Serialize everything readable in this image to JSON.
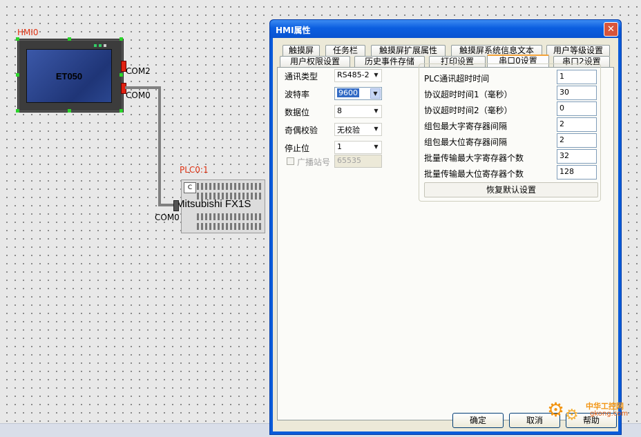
{
  "canvas": {
    "hmi_label": "HMI0",
    "hmi_model": "ET050",
    "hmi_port_com2": "COM2",
    "hmi_port_com0": "COM0",
    "plc_label": "PLC0:1",
    "plc_model": "Mitsubishi FX1S",
    "plc_port": "COM0",
    "plc_small_label": "C"
  },
  "dialog": {
    "title": "HMI属性",
    "close_label": "✕",
    "tabs_row1": [
      "触摸屏",
      "任务栏",
      "触摸屏扩展属性",
      "触摸屏系统信息文本",
      "用户等级设置"
    ],
    "tabs_row2": [
      "用户权限设置",
      "历史事件存储",
      "打印设置",
      "串口0设置",
      "串口2设置"
    ],
    "active_tab": "串口0设置",
    "left_fields": [
      {
        "label": "通讯类型",
        "value": "RS485-2"
      },
      {
        "label": "波特率",
        "value": "9600"
      },
      {
        "label": "数据位",
        "value": "8"
      },
      {
        "label": "奇偶校验",
        "value": "无校验"
      },
      {
        "label": "停止位",
        "value": "1"
      }
    ],
    "broadcast": {
      "label": "广播站号",
      "value": "65535"
    },
    "right_fields": [
      {
        "label": "PLC通讯超时时间",
        "value": "1"
      },
      {
        "label": "协议超时时间1（毫秒）",
        "value": "30"
      },
      {
        "label": "协议超时时间2（毫秒）",
        "value": "0"
      },
      {
        "label": "组包最大字寄存器间隔",
        "value": "2"
      },
      {
        "label": "组包最大位寄存器间隔",
        "value": "2"
      },
      {
        "label": "批量传输最大字寄存器个数",
        "value": "32"
      },
      {
        "label": "批量传输最大位寄存器个数",
        "value": "128"
      }
    ],
    "restore_label": "恢复默认设置",
    "ok_label": "确定",
    "cancel_label": "取消",
    "help_label": "帮助"
  },
  "watermark": {
    "line1": "中华工控网",
    "line2": "gkong.com"
  },
  "colors": {
    "accent_title": "#0b5ee0",
    "tab_highlight": "#f3a33a",
    "label_red": "#e03010"
  }
}
